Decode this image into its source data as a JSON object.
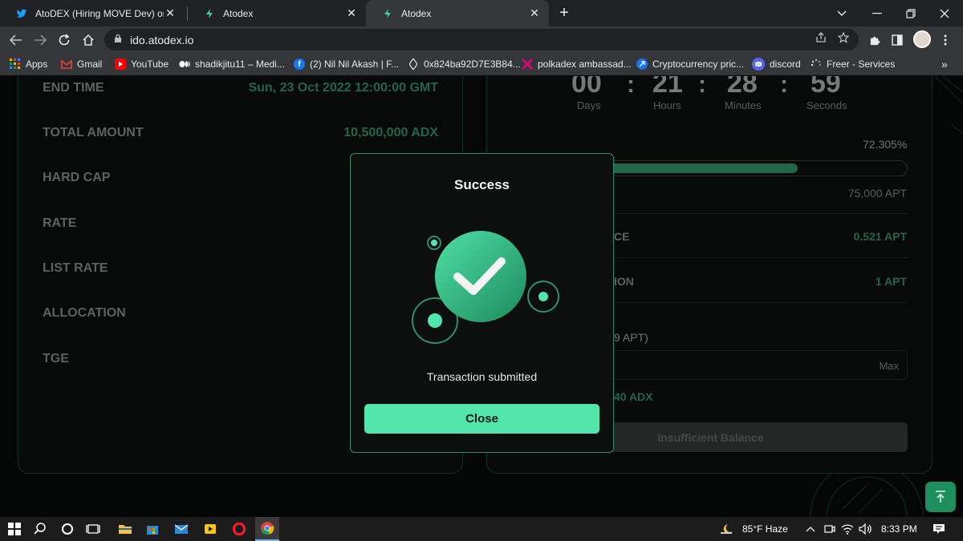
{
  "browser": {
    "tabs": [
      {
        "title": "AtoDEX (Hiring MOVE Dev) on Tw",
        "icon": "twitter-icon"
      },
      {
        "title": "Atodex",
        "icon": "atodex-icon"
      },
      {
        "title": "Atodex",
        "icon": "atodex-icon"
      }
    ],
    "close_glyph": "✕",
    "new_tab_glyph": "+",
    "url": "ido.atodex.io",
    "bookmarks": [
      {
        "label": "Apps",
        "icon": "apps-grid-icon"
      },
      {
        "label": "Gmail",
        "icon": "gmail-icon"
      },
      {
        "label": "YouTube",
        "icon": "youtube-icon"
      },
      {
        "label": "shadikjitu11 – Medi...",
        "icon": "medium-icon"
      },
      {
        "label": "(2) Nil Nil Akash | F...",
        "icon": "facebook-icon"
      },
      {
        "label": "0x824ba92D7E3B84...",
        "icon": "ethereum-icon"
      },
      {
        "label": "polkadex ambassad...",
        "icon": "polkadex-icon"
      },
      {
        "label": "Cryptocurrency pric...",
        "icon": "coinmarketcap-icon"
      },
      {
        "label": "discord",
        "icon": "discord-icon"
      },
      {
        "label": "Freer - Services",
        "icon": "loading-icon"
      }
    ],
    "more_bookmarks_glyph": "»"
  },
  "details": {
    "rows": [
      {
        "label": "END TIME",
        "value": "Sun, 23 Oct 2022 12:00:00 GMT"
      },
      {
        "label": "TOTAL AMOUNT",
        "value": "10,500,000 ADX"
      },
      {
        "label": "HARD CAP",
        "value": ""
      },
      {
        "label": "RATE",
        "value": ""
      },
      {
        "label": "LIST RATE",
        "value": ""
      },
      {
        "label": "ALLOCATION",
        "value": ""
      },
      {
        "label": "TGE",
        "value": ""
      }
    ]
  },
  "sale": {
    "countdown": {
      "days": "00",
      "hours": "21",
      "minutes": "28",
      "seconds": "59",
      "days_label": "Days",
      "hours_label": "Hours",
      "minutes_label": "Minutes",
      "seconds_label": "Seconds",
      "separator": ":"
    },
    "progress_percent_text": "72.305%",
    "progress_fraction": 0.72305,
    "hard_cap_text": "75,000 APT",
    "balance_label_partial": "CE",
    "balance_value": "0.521 APT",
    "min_label_partial": "ION",
    "min_value": "1 APT",
    "input_label_partial": "9 APT)",
    "max_label": "Max",
    "receive_partial": "40 ADX",
    "submit_label": "Insufficient Balance"
  },
  "modal": {
    "title": "Success",
    "message": "Transaction submitted",
    "close_label": "Close"
  },
  "taskbar": {
    "weather": "85°F  Haze",
    "time": "8:33 PM"
  },
  "colors": {
    "accent": "#52e6ad",
    "value_green": "#3fb984",
    "card_border": "#1f5a45"
  }
}
